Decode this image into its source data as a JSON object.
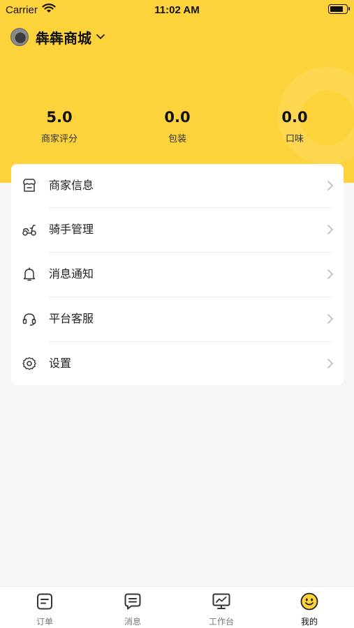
{
  "status_bar": {
    "carrier": "Carrier",
    "time": "11:02 AM",
    "battery_level": 0.85
  },
  "header": {
    "store_name": "犇犇商城",
    "accent_color": "#fdd33c"
  },
  "stats": [
    {
      "value": "5.0",
      "label": "商家评分"
    },
    {
      "value": "0.0",
      "label": "包装"
    },
    {
      "value": "0.0",
      "label": "口味"
    }
  ],
  "menu": [
    {
      "label": "商家信息",
      "icon": "store-icon"
    },
    {
      "label": "骑手管理",
      "icon": "scooter-icon"
    },
    {
      "label": "消息通知",
      "icon": "bell-icon"
    },
    {
      "label": "平台客服",
      "icon": "headset-icon"
    },
    {
      "label": "设置",
      "icon": "gear-icon"
    }
  ],
  "tabs": [
    {
      "label": "订单",
      "icon": "order-icon",
      "active": false
    },
    {
      "label": "消息",
      "icon": "message-icon",
      "active": false
    },
    {
      "label": "工作台",
      "icon": "dashboard-icon",
      "active": false
    },
    {
      "label": "我的",
      "icon": "smiley-icon",
      "active": true
    }
  ]
}
